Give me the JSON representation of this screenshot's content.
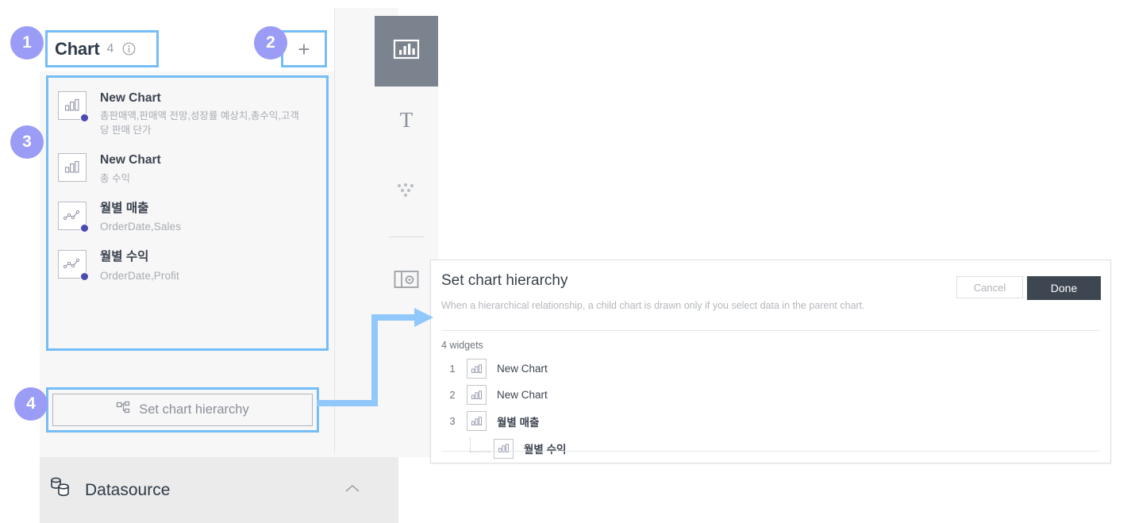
{
  "panel": {
    "header": {
      "title": "Chart",
      "count": "4",
      "info_icon": "info-circle-icon",
      "add_icon": "plus-icon"
    },
    "chart_items": [
      {
        "name": "New Chart",
        "fields": "총판매액,판매액 전망,성장률 예상치,총수익,고객당 판매 단가",
        "icon": "bar-chart-icon",
        "has_dot": true,
        "name_lang": "en",
        "fields_lang": "kr"
      },
      {
        "name": "New Chart",
        "fields": "총 수익",
        "icon": "bar-chart-icon",
        "has_dot": false,
        "name_lang": "en",
        "fields_lang": "kr"
      },
      {
        "name": "월별 매출",
        "fields": "OrderDate,Sales",
        "icon": "line-chart-icon",
        "has_dot": true,
        "name_lang": "kr",
        "fields_lang": "en"
      },
      {
        "name": "월별 수익",
        "fields": "OrderDate,Profit",
        "icon": "line-chart-icon",
        "has_dot": true,
        "name_lang": "kr",
        "fields_lang": "en"
      }
    ],
    "hierarchy_button": {
      "label": "Set chart hierarchy",
      "icon": "hierarchy-tree-icon"
    },
    "datasource": {
      "label": "Datasource",
      "icon": "database-icon",
      "chevron": "chevron-up-icon"
    }
  },
  "toolbar": {
    "items": [
      {
        "icon": "bar-chart-panel-icon",
        "active": true
      },
      {
        "icon": "text-t-icon",
        "active": false
      },
      {
        "icon": "scatter-dots-icon",
        "active": false
      },
      {
        "icon": "layout-settings-icon",
        "active": false
      }
    ]
  },
  "badges": [
    {
      "number": "1"
    },
    {
      "number": "2"
    },
    {
      "number": "3"
    },
    {
      "number": "4"
    }
  ],
  "dialog": {
    "title": "Set chart hierarchy",
    "description": "When a hierarchical relationship, a child chart is drawn only if you select data in the parent chart.",
    "cancel_label": "Cancel",
    "done_label": "Done",
    "widget_count_label": "4 widgets",
    "rows": [
      {
        "index": "1",
        "label": "New Chart",
        "icon": "bar-chart-icon",
        "child": false,
        "lang": "en"
      },
      {
        "index": "2",
        "label": "New Chart",
        "icon": "bar-chart-icon",
        "child": false,
        "lang": "en"
      },
      {
        "index": "3",
        "label": "월별 매출",
        "icon": "bar-chart-icon",
        "child": false,
        "lang": "kr"
      },
      {
        "index": "",
        "label": "월별 수익",
        "icon": "bar-chart-icon",
        "child": true,
        "lang": "kr"
      }
    ]
  },
  "colors": {
    "highlight_blue": "#74bdf7",
    "badge_purple": "#9a9cf5",
    "done_dark": "#3e4651",
    "dot_purple": "#4a4ab0",
    "panel_bg": "#f7f7f8",
    "datasource_bg": "#ebebeb",
    "toolbar_active": "#7b838e"
  }
}
